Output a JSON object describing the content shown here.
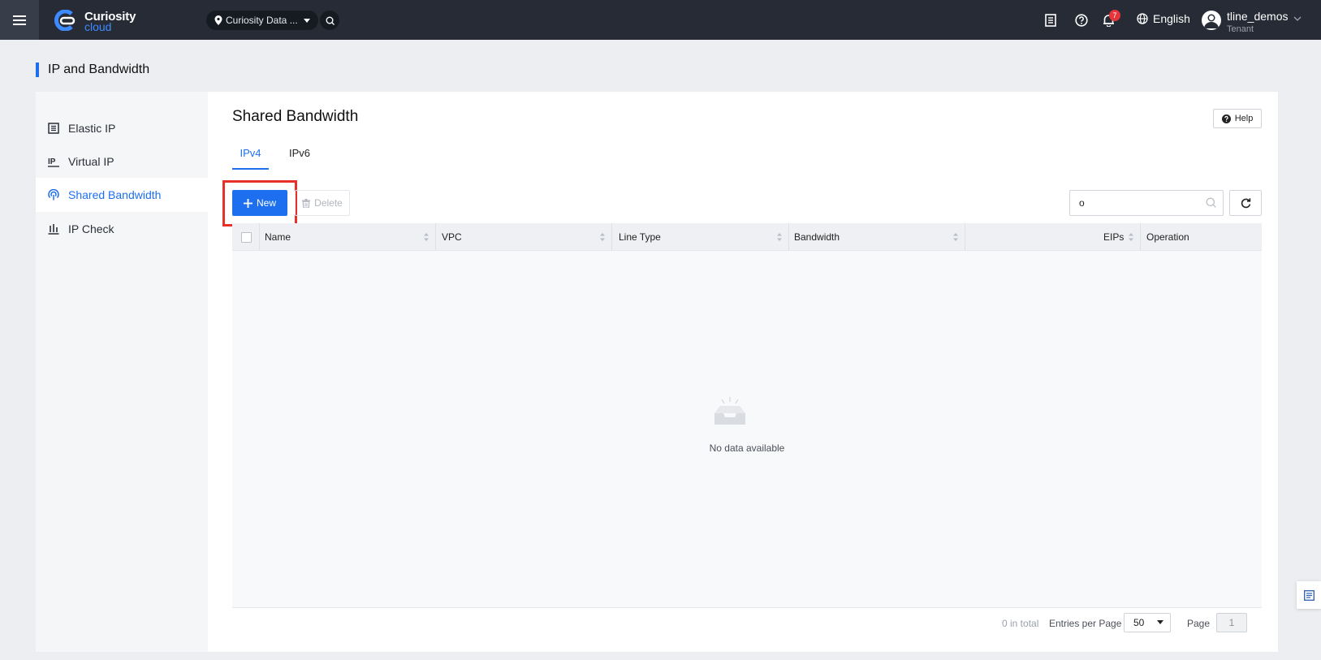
{
  "header": {
    "brand_name": "Curiosity",
    "brand_sub": "cloud",
    "region": "Curiosity Data ...",
    "notification_count": "7",
    "language": "English",
    "user_name": "tline_demos",
    "user_role": "Tenant"
  },
  "page": {
    "title": "IP and Bandwidth"
  },
  "sidebar": {
    "items": [
      {
        "label": "Elastic IP",
        "icon": "elastic-ip-icon",
        "active": false
      },
      {
        "label": "Virtual IP",
        "icon": "virtual-ip-icon",
        "active": false
      },
      {
        "label": "Shared Bandwidth",
        "icon": "shared-bandwidth-icon",
        "active": true
      },
      {
        "label": "IP Check",
        "icon": "ip-check-icon",
        "active": false
      }
    ]
  },
  "main": {
    "title": "Shared Bandwidth",
    "help_label": "Help",
    "tabs": [
      {
        "label": "IPv4",
        "active": true
      },
      {
        "label": "IPv6",
        "active": false
      }
    ],
    "new_label": "New",
    "delete_label": "Delete",
    "search_value": "o"
  },
  "table": {
    "columns": [
      "Name",
      "VPC",
      "Line Type",
      "Bandwidth",
      "EIPs",
      "Operation"
    ],
    "rows": [],
    "empty_text": "No data available"
  },
  "pagination": {
    "total_text": "0 in total",
    "entries_label": "Entries per Page",
    "entries_value": "50",
    "page_label": "Page",
    "page_value": "1"
  },
  "colors": {
    "accent": "#1e6ff0",
    "topbar": "#262b35",
    "highlight": "#e8302a",
    "badge": "#e5353b"
  }
}
